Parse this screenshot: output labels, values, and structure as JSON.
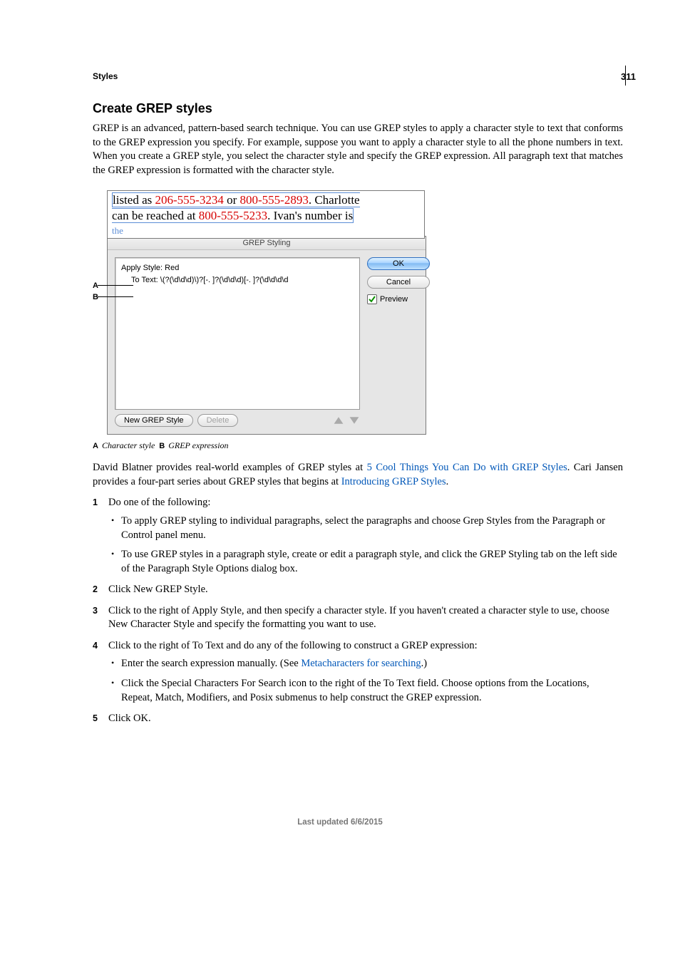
{
  "page": {
    "number": "311",
    "section_label": "Styles",
    "footer": "Last updated 6/6/2015"
  },
  "heading": "Create GREP styles",
  "intro": "GREP is an advanced, pattern-based search technique. You can use GREP styles to apply a character style to text that conforms to the GREP expression you specify. For example, suppose you want to apply a character style to all the phone numbers in text. When you create a GREP style, you select the character style and specify the GREP expression. All paragraph text that matches the GREP expression is formatted with the character style.",
  "figure": {
    "doc_text": {
      "prefix1": "listed as ",
      "phone1": "206-555-3234",
      "mid1": " or ",
      "phone2": "800-555-2893",
      "suffix1": ". Charlotte",
      "line2_prefix": "can be reached at ",
      "phone3": "800-555-5233",
      "line2_suffix": ". Ivan's number is",
      "truncated": "the"
    },
    "panel": {
      "title": "GREP Styling",
      "apply_style": "Apply Style: Red",
      "to_text": "To Text: \\(?(\\d\\d\\d)\\)?[-. ]?(\\d\\d\\d)[-. ]?(\\d\\d\\d\\d",
      "ok": "OK",
      "cancel": "Cancel",
      "preview": "Preview",
      "new_btn": "New GREP Style",
      "delete_btn": "Delete"
    },
    "caption": {
      "a_label": "A",
      "a_text": "Character style",
      "b_label": "B",
      "b_text": "GREP expression"
    }
  },
  "para_after_fig": {
    "t1": "David Blatner provides real-world examples of GREP styles at ",
    "link1": "5 Cool Things You Can Do with GREP Styles",
    "t2": ". Cari Jansen provides a four-part series about GREP styles that begins at ",
    "link2": "Introducing GREP Styles",
    "t3": "."
  },
  "steps": {
    "s1": "Do one of the following:",
    "s1_b1": "To apply GREP styling to individual paragraphs, select the paragraphs and choose Grep Styles from the Paragraph or Control panel menu.",
    "s1_b2": "To use GREP styles in a paragraph style, create or edit a paragraph style, and click the GREP Styling tab on the left side of the Paragraph Style Options dialog box.",
    "s2": "Click New GREP Style.",
    "s3": "Click to the right of Apply Style, and then specify a character style. If you haven't created a character style to use, choose New Character Style and specify the formatting you want to use.",
    "s4": "Click to the right of To Text and do any of the following to construct a GREP expression:",
    "s4_b1_a": "Enter the search expression manually. (See ",
    "s4_b1_link": "Metacharacters for searching",
    "s4_b1_b": ".)",
    "s4_b2": "Click the Special Characters For Search icon to the right of the To Text field. Choose options from the Locations, Repeat, Match, Modifiers, and Posix submenus to help construct the GREP expression.",
    "s5": "Click OK."
  }
}
